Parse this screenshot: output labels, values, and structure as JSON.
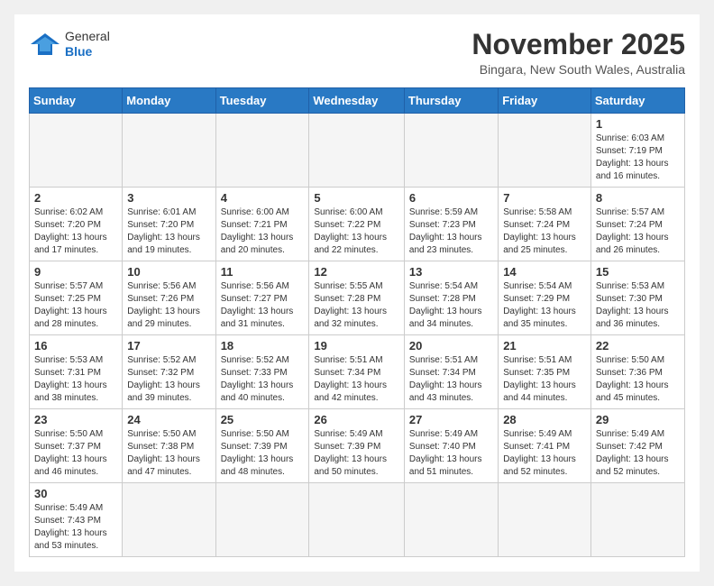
{
  "header": {
    "logo_general": "General",
    "logo_blue": "Blue",
    "month_title": "November 2025",
    "location": "Bingara, New South Wales, Australia"
  },
  "days_of_week": [
    "Sunday",
    "Monday",
    "Tuesday",
    "Wednesday",
    "Thursday",
    "Friday",
    "Saturday"
  ],
  "weeks": [
    [
      {
        "day": "",
        "info": ""
      },
      {
        "day": "",
        "info": ""
      },
      {
        "day": "",
        "info": ""
      },
      {
        "day": "",
        "info": ""
      },
      {
        "day": "",
        "info": ""
      },
      {
        "day": "",
        "info": ""
      },
      {
        "day": "1",
        "info": "Sunrise: 6:03 AM\nSunset: 7:19 PM\nDaylight: 13 hours\nand 16 minutes."
      }
    ],
    [
      {
        "day": "2",
        "info": "Sunrise: 6:02 AM\nSunset: 7:20 PM\nDaylight: 13 hours\nand 17 minutes."
      },
      {
        "day": "3",
        "info": "Sunrise: 6:01 AM\nSunset: 7:20 PM\nDaylight: 13 hours\nand 19 minutes."
      },
      {
        "day": "4",
        "info": "Sunrise: 6:00 AM\nSunset: 7:21 PM\nDaylight: 13 hours\nand 20 minutes."
      },
      {
        "day": "5",
        "info": "Sunrise: 6:00 AM\nSunset: 7:22 PM\nDaylight: 13 hours\nand 22 minutes."
      },
      {
        "day": "6",
        "info": "Sunrise: 5:59 AM\nSunset: 7:23 PM\nDaylight: 13 hours\nand 23 minutes."
      },
      {
        "day": "7",
        "info": "Sunrise: 5:58 AM\nSunset: 7:24 PM\nDaylight: 13 hours\nand 25 minutes."
      },
      {
        "day": "8",
        "info": "Sunrise: 5:57 AM\nSunset: 7:24 PM\nDaylight: 13 hours\nand 26 minutes."
      }
    ],
    [
      {
        "day": "9",
        "info": "Sunrise: 5:57 AM\nSunset: 7:25 PM\nDaylight: 13 hours\nand 28 minutes."
      },
      {
        "day": "10",
        "info": "Sunrise: 5:56 AM\nSunset: 7:26 PM\nDaylight: 13 hours\nand 29 minutes."
      },
      {
        "day": "11",
        "info": "Sunrise: 5:56 AM\nSunset: 7:27 PM\nDaylight: 13 hours\nand 31 minutes."
      },
      {
        "day": "12",
        "info": "Sunrise: 5:55 AM\nSunset: 7:28 PM\nDaylight: 13 hours\nand 32 minutes."
      },
      {
        "day": "13",
        "info": "Sunrise: 5:54 AM\nSunset: 7:28 PM\nDaylight: 13 hours\nand 34 minutes."
      },
      {
        "day": "14",
        "info": "Sunrise: 5:54 AM\nSunset: 7:29 PM\nDaylight: 13 hours\nand 35 minutes."
      },
      {
        "day": "15",
        "info": "Sunrise: 5:53 AM\nSunset: 7:30 PM\nDaylight: 13 hours\nand 36 minutes."
      }
    ],
    [
      {
        "day": "16",
        "info": "Sunrise: 5:53 AM\nSunset: 7:31 PM\nDaylight: 13 hours\nand 38 minutes."
      },
      {
        "day": "17",
        "info": "Sunrise: 5:52 AM\nSunset: 7:32 PM\nDaylight: 13 hours\nand 39 minutes."
      },
      {
        "day": "18",
        "info": "Sunrise: 5:52 AM\nSunset: 7:33 PM\nDaylight: 13 hours\nand 40 minutes."
      },
      {
        "day": "19",
        "info": "Sunrise: 5:51 AM\nSunset: 7:34 PM\nDaylight: 13 hours\nand 42 minutes."
      },
      {
        "day": "20",
        "info": "Sunrise: 5:51 AM\nSunset: 7:34 PM\nDaylight: 13 hours\nand 43 minutes."
      },
      {
        "day": "21",
        "info": "Sunrise: 5:51 AM\nSunset: 7:35 PM\nDaylight: 13 hours\nand 44 minutes."
      },
      {
        "day": "22",
        "info": "Sunrise: 5:50 AM\nSunset: 7:36 PM\nDaylight: 13 hours\nand 45 minutes."
      }
    ],
    [
      {
        "day": "23",
        "info": "Sunrise: 5:50 AM\nSunset: 7:37 PM\nDaylight: 13 hours\nand 46 minutes."
      },
      {
        "day": "24",
        "info": "Sunrise: 5:50 AM\nSunset: 7:38 PM\nDaylight: 13 hours\nand 47 minutes."
      },
      {
        "day": "25",
        "info": "Sunrise: 5:50 AM\nSunset: 7:39 PM\nDaylight: 13 hours\nand 48 minutes."
      },
      {
        "day": "26",
        "info": "Sunrise: 5:49 AM\nSunset: 7:39 PM\nDaylight: 13 hours\nand 50 minutes."
      },
      {
        "day": "27",
        "info": "Sunrise: 5:49 AM\nSunset: 7:40 PM\nDaylight: 13 hours\nand 51 minutes."
      },
      {
        "day": "28",
        "info": "Sunrise: 5:49 AM\nSunset: 7:41 PM\nDaylight: 13 hours\nand 52 minutes."
      },
      {
        "day": "29",
        "info": "Sunrise: 5:49 AM\nSunset: 7:42 PM\nDaylight: 13 hours\nand 52 minutes."
      }
    ],
    [
      {
        "day": "30",
        "info": "Sunrise: 5:49 AM\nSunset: 7:43 PM\nDaylight: 13 hours\nand 53 minutes."
      },
      {
        "day": "",
        "info": ""
      },
      {
        "day": "",
        "info": ""
      },
      {
        "day": "",
        "info": ""
      },
      {
        "day": "",
        "info": ""
      },
      {
        "day": "",
        "info": ""
      },
      {
        "day": "",
        "info": ""
      }
    ]
  ]
}
